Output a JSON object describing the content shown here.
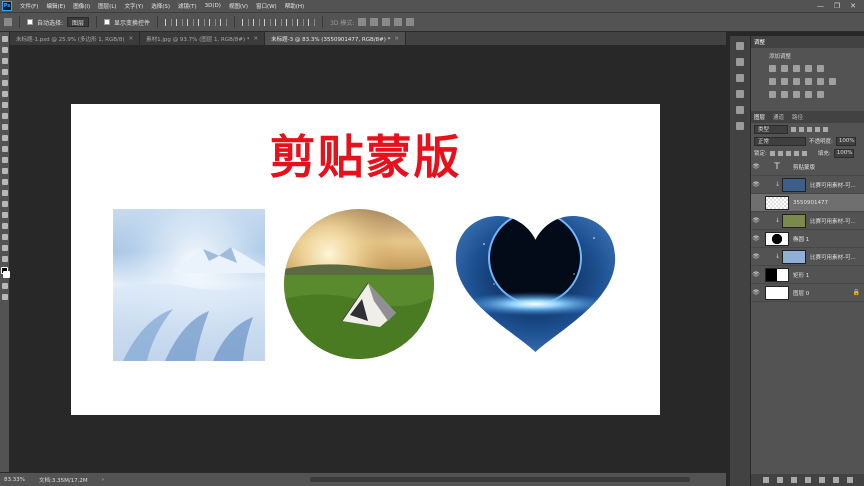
{
  "menu": {
    "logo": "Ps",
    "items": [
      "文件(F)",
      "编辑(E)",
      "图像(I)",
      "图层(L)",
      "文字(Y)",
      "选择(S)",
      "滤镜(T)",
      "3D(D)",
      "视图(V)",
      "窗口(W)",
      "帮助(H)"
    ],
    "window_controls": [
      "—",
      "❐",
      "✕"
    ]
  },
  "options_bar": {
    "auto_select_label": "自动选择:",
    "auto_select_value": "图层",
    "show_transform_label": "显示变换控件",
    "mode_3d_label": "3D 模式:"
  },
  "tabs": [
    {
      "label": "未标题-1.psd @ 25.9% (多边形 1, RGB/8)",
      "active": false
    },
    {
      "label": "素材1.jpg @ 93.7% (图层 1, RGB/8#) *",
      "active": false
    },
    {
      "label": "未标题-3 @ 83.3% (3550901477, RGB/8#) *",
      "active": true
    }
  ],
  "canvas": {
    "title": "剪贴蒙版"
  },
  "status": {
    "zoom": "83.33%",
    "doc": "文档:3.35M/17.2M",
    "arrow": "›"
  },
  "adjust_panel": {
    "tab": "调整",
    "add_label": "添加调整"
  },
  "layers_panel": {
    "tabs": [
      "图层",
      "通道",
      "路径"
    ],
    "filter_kind": "类型",
    "blend_mode": "正常",
    "opacity_label": "不透明度:",
    "opacity_value": "100%",
    "lock_label": "锁定:",
    "fill_label": "填充:",
    "fill_value": "100%",
    "layers": [
      {
        "name": "剪贴蒙版",
        "kind": "text",
        "selected": false,
        "clip": false,
        "thumb": ""
      },
      {
        "name": "比赛可用素材-可...",
        "kind": "image",
        "selected": false,
        "clip": true,
        "thumb": "#3c5f8a"
      },
      {
        "name": "3550901477",
        "kind": "image",
        "selected": true,
        "clip": false,
        "thumb": "#c8c8c8"
      },
      {
        "name": "比赛可用素材-可...",
        "kind": "image",
        "selected": false,
        "clip": true,
        "thumb": "#7a8a4a"
      },
      {
        "name": "椭圆 1",
        "kind": "shape",
        "selected": false,
        "clip": false,
        "thumb": "#ffffff"
      },
      {
        "name": "比赛可用素材-可...",
        "kind": "image",
        "selected": false,
        "clip": true,
        "thumb": "#8fb0d6"
      },
      {
        "name": "矩形 1",
        "kind": "shape",
        "selected": false,
        "clip": false,
        "thumb": "#ffffff"
      },
      {
        "name": "图层 0",
        "kind": "fill",
        "selected": false,
        "clip": false,
        "thumb": "#ffffff",
        "locked": true
      }
    ]
  }
}
